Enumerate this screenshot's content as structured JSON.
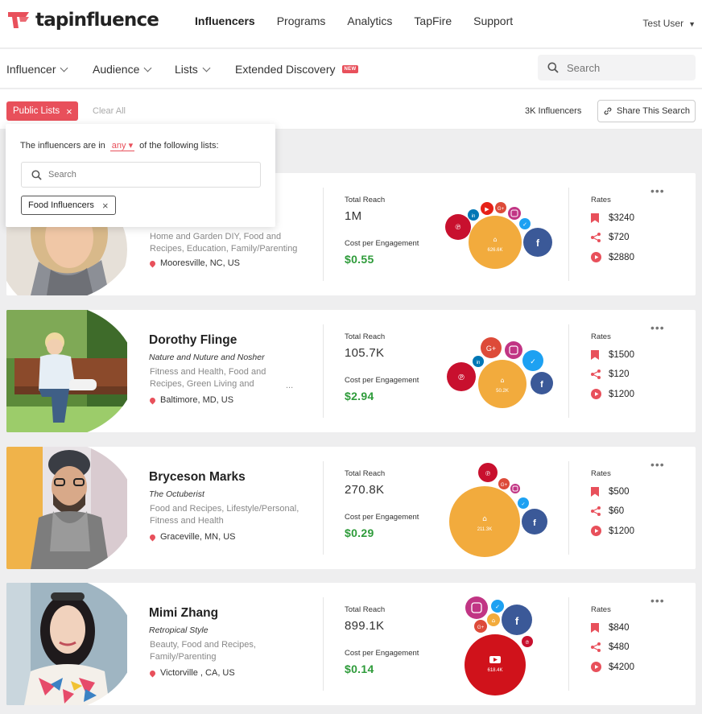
{
  "brand": {
    "name": "tapinfluence",
    "accent": "#e8505b"
  },
  "topnav": {
    "items": [
      "Influencers",
      "Programs",
      "Analytics",
      "TapFire",
      "Support"
    ],
    "active": "Influencers"
  },
  "user": {
    "name": "Test User"
  },
  "filters": {
    "influencer": "Influencer",
    "audience": "Audience",
    "lists": "Lists",
    "extended": "Extended Discovery",
    "new_badge": "NEW",
    "search_placeholder": "Search"
  },
  "chips": {
    "public_lists": "Public Lists",
    "clear_all": "Clear All",
    "count": "3K Influencers",
    "share": "Share This Search"
  },
  "popover": {
    "prefix": "The influencers are in",
    "mode": "any",
    "suffix": "of the following lists:",
    "search_placeholder": "Search",
    "selected_list": "Food Influencers"
  },
  "labels": {
    "total_reach": "Total Reach",
    "cpe": "Cost per Engagement",
    "rates": "Rates",
    "more": "•••"
  },
  "influencers": [
    {
      "name": "",
      "tagline": "",
      "categories": "Home and Garden DIY, Food and Recipes, Education, Family/Parenting",
      "location": "Mooresville, NC, US",
      "total_reach": "1M",
      "cpe": "$0.55",
      "rates": [
        "$3240",
        "$720",
        "$2880"
      ],
      "bubble_value": "626.6K"
    },
    {
      "name": "Dorothy Flinge",
      "tagline": "Nature and Nuture and Nosher",
      "categories": "Fitness and Health, Food and Recipes, Green Living and",
      "location": "Baltimore, MD, US",
      "total_reach": "105.7K",
      "cpe": "$2.94",
      "rates": [
        "$1500",
        "$120",
        "$1200"
      ],
      "bubble_value": "50.2K"
    },
    {
      "name": "Bryceson Marks",
      "tagline": "The Octuberist",
      "categories": "Food and Recipes, Lifestyle/Personal, Fitness and Health",
      "location": "Graceville, MN, US",
      "total_reach": "270.8K",
      "cpe": "$0.29",
      "rates": [
        "$500",
        "$60",
        "$1200"
      ],
      "bubble_value": "211.3K"
    },
    {
      "name": "Mimi Zhang",
      "tagline": "Retropical Style",
      "categories": "Beauty, Food and Recipes, Family/Parenting",
      "location": "Victorville , CA, US",
      "total_reach": "899.1K",
      "cpe": "$0.14",
      "rates": [
        "$840",
        "$480",
        "$4200"
      ],
      "bubble_value": "618.4K"
    }
  ],
  "icons": {
    "rate_1": "bookmark-icon",
    "rate_2": "share-icon",
    "rate_3": "play-icon"
  }
}
